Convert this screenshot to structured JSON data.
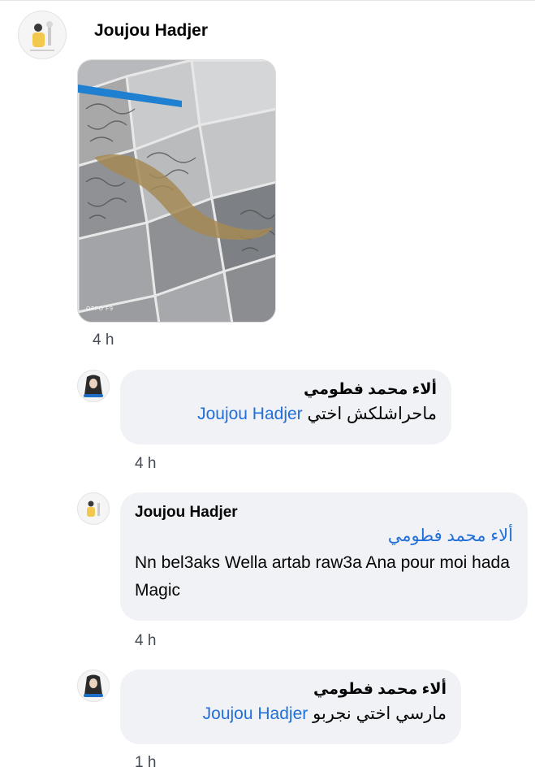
{
  "post": {
    "author": "Joujou Hadjer",
    "photo_watermark": "OPPO F9",
    "time": "4 h"
  },
  "comments": [
    {
      "author": "ألاء محمد فطومي",
      "mention": "Joujou Hadjer",
      "text": "ماحراشلكش اختي",
      "time": "4 h"
    },
    {
      "author": "Joujou Hadjer",
      "mention": "ألاء محمد فطومي",
      "text": "Nn bel3aks Wella artab raw3a Ana pour moi hada Magic",
      "time": "4 h"
    },
    {
      "author": "ألاء محمد فطومي",
      "mention": "Joujou Hadjer",
      "text": "مارسي اختي نجربو",
      "time": "1 h"
    }
  ],
  "colors": {
    "mention": "#216fdb",
    "bubble": "#f0f2f5",
    "time": "#444b55"
  }
}
